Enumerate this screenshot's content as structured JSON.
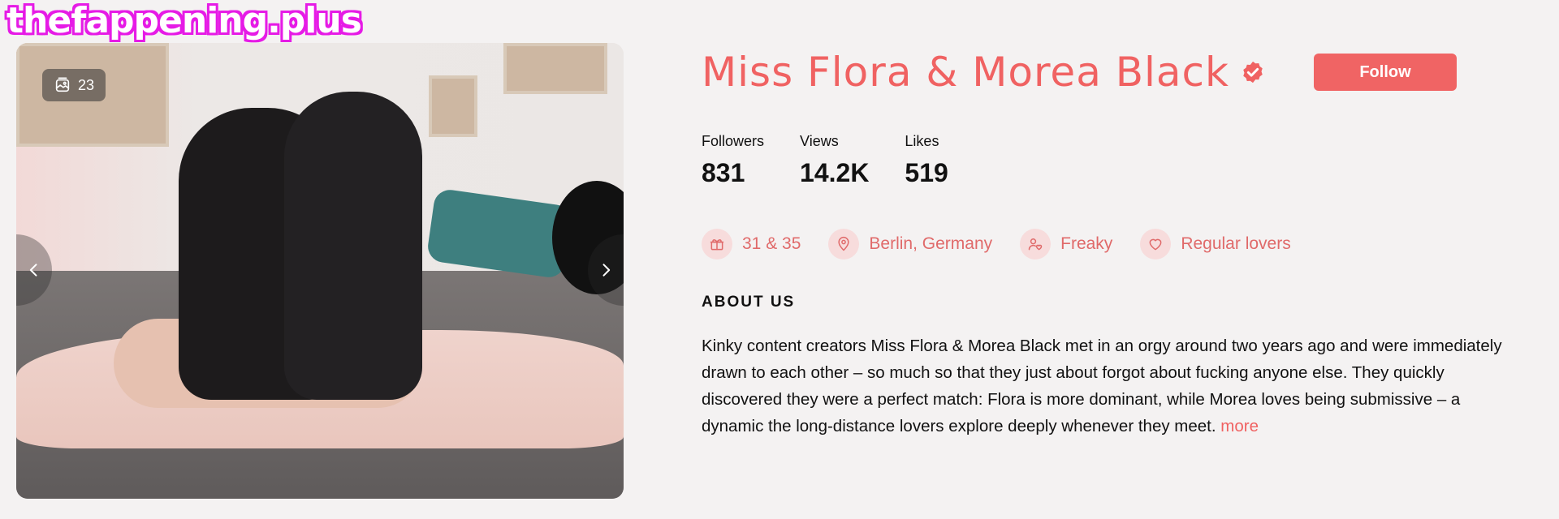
{
  "watermark": "thefappening.plus",
  "gallery": {
    "photo_count": "23",
    "photo_icon": "images-icon",
    "prev_icon": "chevron-left-icon",
    "next_icon": "chevron-right-icon"
  },
  "profile": {
    "name": "Miss Flora & Morea Black",
    "verified_icon": "verified-badge-icon",
    "follow_label": "Follow",
    "stats": [
      {
        "label": "Followers",
        "value": "831"
      },
      {
        "label": "Views",
        "value": "14.2K"
      },
      {
        "label": "Likes",
        "value": "519"
      }
    ],
    "tags": [
      {
        "icon": "gift-icon",
        "text": "31 & 35"
      },
      {
        "icon": "location-pin-icon",
        "text": "Berlin, Germany"
      },
      {
        "icon": "user-heart-icon",
        "text": "Freaky"
      },
      {
        "icon": "heart-icon",
        "text": "Regular lovers"
      }
    ],
    "about_title": "ABOUT US",
    "about_text": "Kinky content creators Miss Flora & Morea Black met in an orgy around two years ago and were immediately drawn to each other – so much so that they just about forgot about fucking anyone else. They quickly discovered they were a perfect match: Flora is more dominant, while Morea loves being submissive – a dynamic the long-distance lovers explore deeply whenever they meet.",
    "more_label": "more"
  },
  "colors": {
    "accent": "#f06262",
    "tag_bg": "#f7dcdc",
    "page_bg": "#f4f2f2"
  }
}
